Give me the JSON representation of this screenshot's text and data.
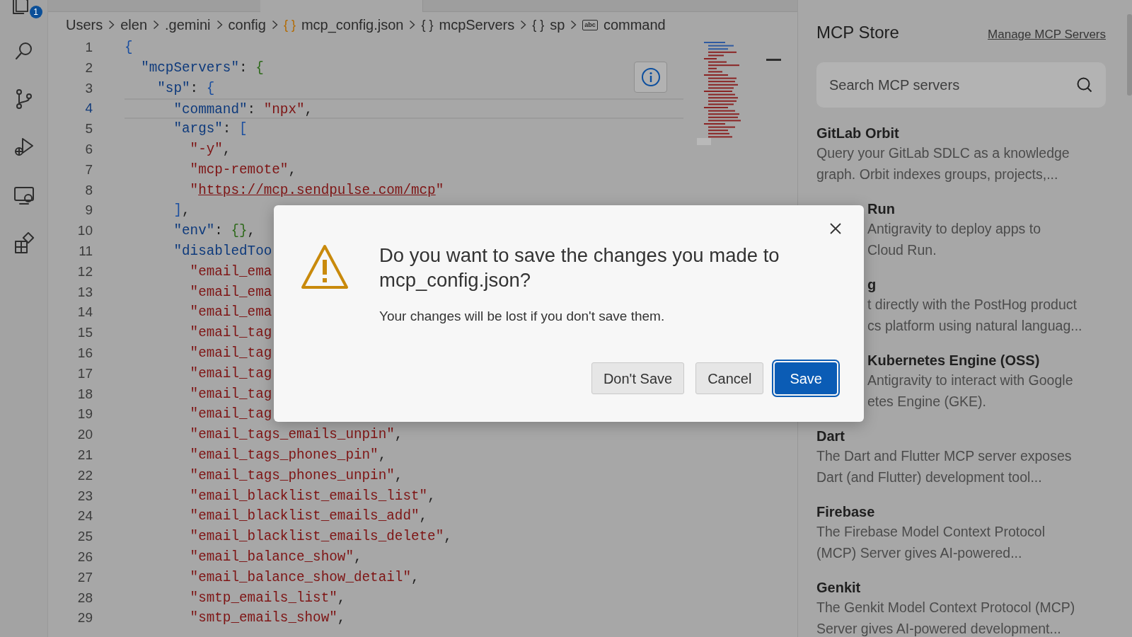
{
  "activity_bar": {
    "items": [
      {
        "kind": "files",
        "badge": "1"
      },
      {
        "kind": "search"
      },
      {
        "kind": "source_control"
      },
      {
        "kind": "run_debug"
      },
      {
        "kind": "remote"
      },
      {
        "kind": "extensions"
      }
    ]
  },
  "breadcrumb": [
    {
      "label": "Users"
    },
    {
      "label": "elen"
    },
    {
      "label": ".gemini"
    },
    {
      "label": "config"
    },
    {
      "label": "mcp_config.json",
      "icon": {
        "kind": "json",
        "text": "{ }"
      }
    },
    {
      "label": "mcpServers",
      "icon": {
        "kind": "object",
        "text": "{ }"
      }
    },
    {
      "label": "sp",
      "icon": {
        "kind": "object",
        "text": "{ }"
      }
    },
    {
      "label": "command",
      "icon": {
        "kind": "string",
        "text": "abc"
      }
    }
  ],
  "lines": [
    {
      "number": "1",
      "current": false,
      "tokens": [
        {
          "text": "{",
          "kind": "bracket"
        }
      ]
    },
    {
      "number": "2",
      "current": false,
      "tokens": [
        {
          "text": "  \"mcpServers\"",
          "kind": "key"
        },
        {
          "text": ": ",
          "kind": "punct"
        },
        {
          "text": "{",
          "kind": "bracket2"
        }
      ]
    },
    {
      "number": "3",
      "current": false,
      "tokens": [
        {
          "text": "    \"sp\"",
          "kind": "key"
        },
        {
          "text": ": ",
          "kind": "punct"
        },
        {
          "text": "{",
          "kind": "bracket"
        }
      ]
    },
    {
      "number": "4",
      "current": true,
      "tokens": [
        {
          "text": "      \"command\"",
          "kind": "key"
        },
        {
          "text": ": ",
          "kind": "punct"
        },
        {
          "text": "\"npx\"",
          "kind": "string"
        },
        {
          "text": ",",
          "kind": "punct"
        }
      ]
    },
    {
      "number": "5",
      "current": false,
      "tokens": [
        {
          "text": "      \"args\"",
          "kind": "key"
        },
        {
          "text": ": ",
          "kind": "punct"
        },
        {
          "text": "[",
          "kind": "bracket"
        }
      ]
    },
    {
      "number": "6",
      "current": false,
      "tokens": [
        {
          "text": "        \"-y\"",
          "kind": "string"
        },
        {
          "text": ",",
          "kind": "punct"
        }
      ]
    },
    {
      "number": "7",
      "current": false,
      "tokens": [
        {
          "text": "        \"mcp-remote\"",
          "kind": "string"
        },
        {
          "text": ",",
          "kind": "punct"
        }
      ]
    },
    {
      "number": "8",
      "current": false,
      "tokens": [
        {
          "text": "        \"",
          "kind": "string"
        },
        {
          "text": "https://mcp.sendpulse.com/mcp",
          "kind": "link"
        },
        {
          "text": "\"",
          "kind": "string"
        }
      ]
    },
    {
      "number": "9",
      "current": false,
      "tokens": [
        {
          "text": "      ]",
          "kind": "bracket"
        },
        {
          "text": ",",
          "kind": "punct"
        }
      ]
    },
    {
      "number": "10",
      "current": false,
      "tokens": [
        {
          "text": "      \"env\"",
          "kind": "key"
        },
        {
          "text": ": ",
          "kind": "punct"
        },
        {
          "text": "{}",
          "kind": "bracket2"
        },
        {
          "text": ",",
          "kind": "punct"
        }
      ]
    },
    {
      "number": "11",
      "current": false,
      "tokens": [
        {
          "text": "      \"disabledToo",
          "kind": "key"
        }
      ]
    },
    {
      "number": "12",
      "current": false,
      "tokens": [
        {
          "text": "        \"email_ema",
          "kind": "string"
        }
      ]
    },
    {
      "number": "13",
      "current": false,
      "tokens": [
        {
          "text": "        \"email_ema",
          "kind": "string"
        }
      ]
    },
    {
      "number": "14",
      "current": false,
      "tokens": [
        {
          "text": "        \"email_ema",
          "kind": "string"
        }
      ]
    },
    {
      "number": "15",
      "current": false,
      "tokens": [
        {
          "text": "        \"email_tag",
          "kind": "string"
        }
      ]
    },
    {
      "number": "16",
      "current": false,
      "tokens": [
        {
          "text": "        \"email_tag",
          "kind": "string"
        }
      ]
    },
    {
      "number": "17",
      "current": false,
      "tokens": [
        {
          "text": "        \"email_tag",
          "kind": "string"
        }
      ]
    },
    {
      "number": "18",
      "current": false,
      "tokens": [
        {
          "text": "        \"email_tag",
          "kind": "string"
        }
      ]
    },
    {
      "number": "19",
      "current": false,
      "tokens": [
        {
          "text": "        \"email_tag",
          "kind": "string"
        }
      ]
    },
    {
      "number": "20",
      "current": false,
      "tokens": [
        {
          "text": "        \"email_tags_emails_unpin\"",
          "kind": "string"
        },
        {
          "text": ",",
          "kind": "punct"
        }
      ]
    },
    {
      "number": "21",
      "current": false,
      "tokens": [
        {
          "text": "        \"email_tags_phones_pin\"",
          "kind": "string"
        },
        {
          "text": ",",
          "kind": "punct"
        }
      ]
    },
    {
      "number": "22",
      "current": false,
      "tokens": [
        {
          "text": "        \"email_tags_phones_unpin\"",
          "kind": "string"
        },
        {
          "text": ",",
          "kind": "punct"
        }
      ]
    },
    {
      "number": "23",
      "current": false,
      "tokens": [
        {
          "text": "        \"email_blacklist_emails_list\"",
          "kind": "string"
        },
        {
          "text": ",",
          "kind": "punct"
        }
      ]
    },
    {
      "number": "24",
      "current": false,
      "tokens": [
        {
          "text": "        \"email_blacklist_emails_add\"",
          "kind": "string"
        },
        {
          "text": ",",
          "kind": "punct"
        }
      ]
    },
    {
      "number": "25",
      "current": false,
      "tokens": [
        {
          "text": "        \"email_blacklist_emails_delete\"",
          "kind": "string"
        },
        {
          "text": ",",
          "kind": "punct"
        }
      ]
    },
    {
      "number": "26",
      "current": false,
      "tokens": [
        {
          "text": "        \"email_balance_show\"",
          "kind": "string"
        },
        {
          "text": ",",
          "kind": "punct"
        }
      ]
    },
    {
      "number": "27",
      "current": false,
      "tokens": [
        {
          "text": "        \"email_balance_show_detail\"",
          "kind": "string"
        },
        {
          "text": ",",
          "kind": "punct"
        }
      ]
    },
    {
      "number": "28",
      "current": false,
      "tokens": [
        {
          "text": "        \"smtp_emails_list\"",
          "kind": "string"
        },
        {
          "text": ",",
          "kind": "punct"
        }
      ]
    },
    {
      "number": "29",
      "current": false,
      "tokens": [
        {
          "text": "        \"smtp_emails_show\"",
          "kind": "string"
        },
        {
          "text": ",",
          "kind": "punct"
        }
      ]
    }
  ],
  "store": {
    "title": "MCP Store",
    "manage_link": "Manage MCP Servers",
    "search": {
      "placeholder": "Search MCP servers"
    },
    "items": [
      {
        "title": "GitLab Orbit",
        "description": [
          {
            "text": "Query your GitLab SDLC as a knowledge"
          },
          {
            "text": "graph. Orbit indexes groups, projects,..."
          }
        ]
      },
      {
        "title": "Run",
        "title_covered": true,
        "description": [
          {
            "text": "Antigravity to deploy apps to",
            "covered": true
          },
          {
            "text": "Cloud Run.",
            "covered": true
          }
        ]
      },
      {
        "title": "g",
        "title_covered": true,
        "description": [
          {
            "text": "t directly with the PostHog product",
            "covered": true
          },
          {
            "text": "cs platform using natural languag...",
            "covered": true
          }
        ]
      },
      {
        "title": "Kubernetes Engine (OSS)",
        "title_covered": true,
        "description": [
          {
            "text": "Antigravity to interact with Google",
            "covered": true
          },
          {
            "text": "etes Engine (GKE).",
            "covered": true
          }
        ]
      },
      {
        "title": "Dart",
        "description": [
          {
            "text": "The Dart and Flutter MCP server exposes"
          },
          {
            "text": "Dart (and Flutter) development tool..."
          }
        ]
      },
      {
        "title": "Firebase",
        "description": [
          {
            "text": "The Firebase Model Context Protocol"
          },
          {
            "text": "(MCP) Server gives AI-powered..."
          }
        ]
      },
      {
        "title": "Genkit",
        "description": [
          {
            "text": "The Genkit Model Context Protocol (MCP)"
          },
          {
            "text": "Server gives AI-powered development..."
          }
        ]
      }
    ]
  },
  "dialog": {
    "title": "Do you want to save the changes you made to mcp_config.json?",
    "message": "Your changes will be lost if you don't save them.",
    "buttons": [
      {
        "label": "Don't Save",
        "kind": "secondary",
        "focused": false
      },
      {
        "label": "Cancel",
        "kind": "secondary",
        "focused": false
      },
      {
        "label": "Save",
        "kind": "primary",
        "focused": true
      }
    ]
  }
}
